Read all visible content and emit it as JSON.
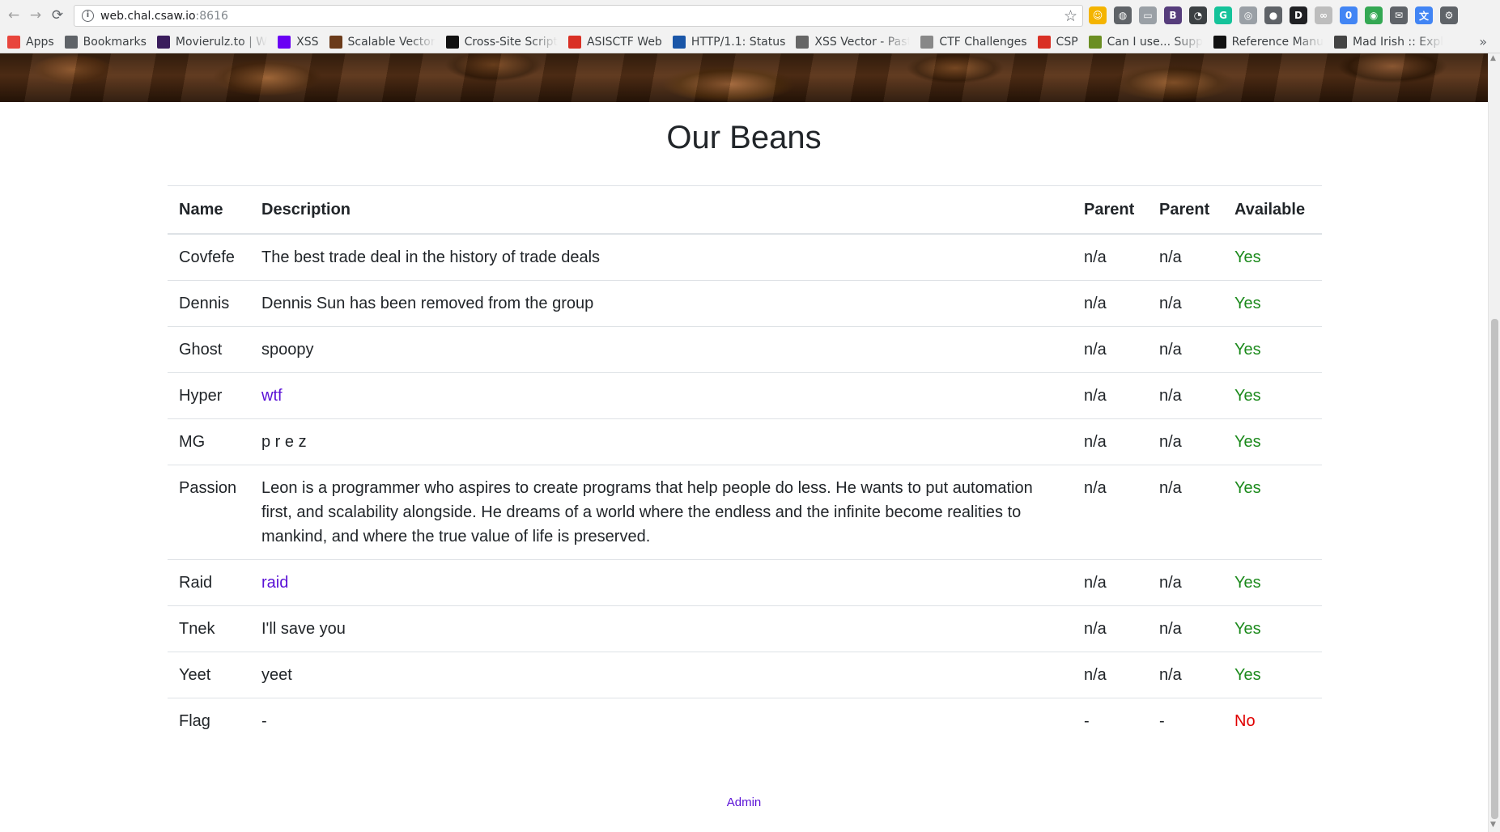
{
  "browser": {
    "url_host": "web.chal.csaw.io",
    "url_port": ":8616",
    "back_icon": "←",
    "forward_icon": "→",
    "reload_icon": "⟳",
    "star_icon": "☆",
    "bookmarks": [
      {
        "label": "Apps",
        "icon": "apps-grid-icon",
        "color": "#e8453c"
      },
      {
        "label": "Bookmarks",
        "icon": "star-icon",
        "color": "#5f6368"
      },
      {
        "label": "Movierulz.to | W",
        "icon": "movierulz-icon",
        "color": "#3a1d5c"
      },
      {
        "label": "XSS",
        "icon": "xss-icon",
        "color": "#6a00f4"
      },
      {
        "label": "Scalable Vector",
        "icon": "svg-icon",
        "color": "#6b3b1a"
      },
      {
        "label": "Cross-Site Script",
        "icon": "v-icon",
        "color": "#111111"
      },
      {
        "label": "ASISCTF Web",
        "icon": "asis-icon",
        "color": "#d93025"
      },
      {
        "label": "HTTP/1.1: Status",
        "icon": "w3-icon",
        "color": "#1a56a8"
      },
      {
        "label": "XSS Vector - Past",
        "icon": "pastebin-icon",
        "color": "#666666"
      },
      {
        "label": "CTF Challenges",
        "icon": "page-icon",
        "color": "#888888"
      },
      {
        "label": "CSP",
        "icon": "csp-icon",
        "color": "#d93025"
      },
      {
        "label": "Can I use... Supp",
        "icon": "caniuse-icon",
        "color": "#6b8e23"
      },
      {
        "label": "Reference Manu",
        "icon": "github-icon",
        "color": "#111111"
      },
      {
        "label": "Mad Irish :: Expl",
        "icon": "madirish-icon",
        "color": "#444444"
      }
    ],
    "more_icon": "»",
    "extensions": [
      {
        "icon": "emoji-extension-icon",
        "color": "#f4b400",
        "glyph": "☺"
      },
      {
        "icon": "tamper-extension-icon",
        "color": "#5f6368",
        "glyph": "◍"
      },
      {
        "icon": "folder-extension-icon",
        "color": "#9aa0a6",
        "glyph": "▭"
      },
      {
        "icon": "bootstrap-extension-icon",
        "color": "#563d7c",
        "glyph": "B"
      },
      {
        "icon": "speed-extension-icon",
        "color": "#3c4043",
        "glyph": "◔"
      },
      {
        "icon": "grammarly-extension-icon",
        "color": "#15c39a",
        "glyph": "G"
      },
      {
        "icon": "globe-extension-icon",
        "color": "#9aa0a6",
        "glyph": "◎"
      },
      {
        "icon": "users-extension-icon",
        "color": "#5f6368",
        "glyph": "●"
      },
      {
        "icon": "d-extension-icon",
        "color": "#202124",
        "glyph": "D"
      },
      {
        "icon": "link-extension-icon",
        "color": "#bdbdbd",
        "glyph": "∞"
      },
      {
        "icon": "badge-extension-icon",
        "color": "#4285f4",
        "glyph": "0"
      },
      {
        "icon": "earth-extension-icon",
        "color": "#34a853",
        "glyph": "◉"
      },
      {
        "icon": "mail-extension-icon",
        "color": "#5f6368",
        "glyph": "✉"
      },
      {
        "icon": "translate-extension-icon",
        "color": "#4285f4",
        "glyph": "文"
      },
      {
        "icon": "settings-extension-icon",
        "color": "#5f6368",
        "glyph": "⚙"
      }
    ]
  },
  "page": {
    "title": "Our Beans",
    "table": {
      "headers": [
        "Name",
        "Description",
        "Parent",
        "Parent",
        "Available"
      ],
      "rows": [
        {
          "name": "Covfefe",
          "description": "The best trade deal in the history of trade deals",
          "desc_is_link": false,
          "parent1": "n/a",
          "parent2": "n/a",
          "available": "Yes"
        },
        {
          "name": "Dennis",
          "description": "Dennis Sun has been removed from the group",
          "desc_is_link": false,
          "parent1": "n/a",
          "parent2": "n/a",
          "available": "Yes"
        },
        {
          "name": "Ghost",
          "description": "spoopy",
          "desc_is_link": false,
          "parent1": "n/a",
          "parent2": "n/a",
          "available": "Yes"
        },
        {
          "name": "Hyper",
          "description": "wtf",
          "desc_is_link": true,
          "parent1": "n/a",
          "parent2": "n/a",
          "available": "Yes"
        },
        {
          "name": "MG",
          "description": "p r e z",
          "desc_is_link": false,
          "parent1": "n/a",
          "parent2": "n/a",
          "available": "Yes"
        },
        {
          "name": "Passion",
          "description": "Leon is a programmer who aspires to create programs that help people do less. He wants to put automation first, and scalability alongside. He dreams of a world where the endless and the infinite become realities to mankind, and where the true value of life is preserved.",
          "desc_is_link": false,
          "parent1": "n/a",
          "parent2": "n/a",
          "available": "Yes"
        },
        {
          "name": "Raid",
          "description": "raid",
          "desc_is_link": true,
          "parent1": "n/a",
          "parent2": "n/a",
          "available": "Yes"
        },
        {
          "name": "Tnek",
          "description": "I'll save you",
          "desc_is_link": false,
          "parent1": "n/a",
          "parent2": "n/a",
          "available": "Yes"
        },
        {
          "name": "Yeet",
          "description": "yeet",
          "desc_is_link": false,
          "parent1": "n/a",
          "parent2": "n/a",
          "available": "Yes"
        },
        {
          "name": "Flag",
          "description": "-",
          "desc_is_link": false,
          "parent1": "-",
          "parent2": "-",
          "available": "No"
        }
      ]
    },
    "admin_link": "Admin"
  },
  "colors": {
    "link": "#5a11d6",
    "available_yes": "#1c8a1c",
    "available_no": "#e00000"
  }
}
